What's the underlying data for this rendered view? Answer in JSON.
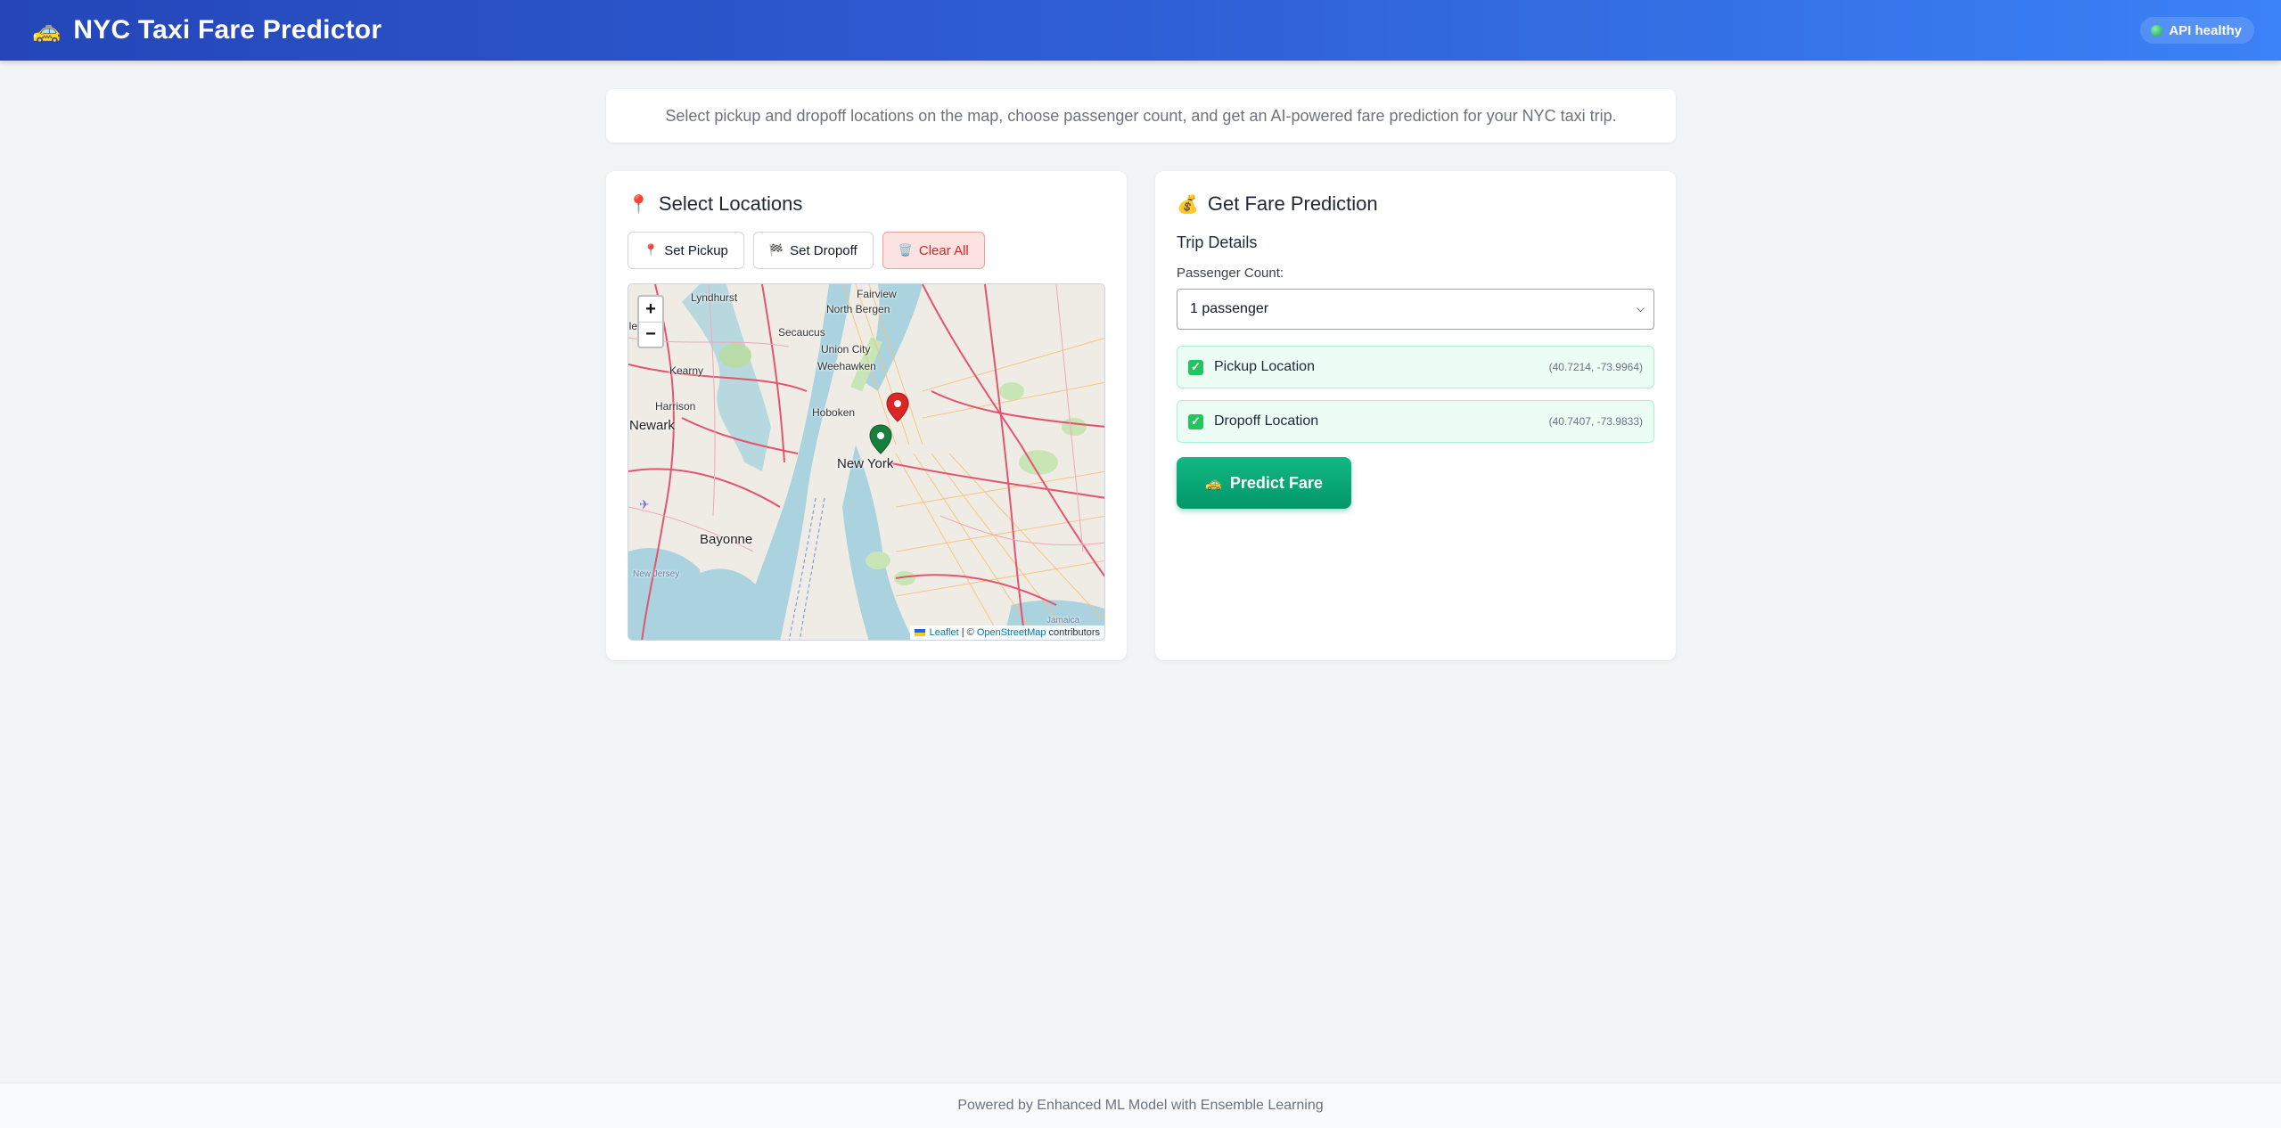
{
  "header": {
    "icon": "taxi-icon",
    "title": "NYC Taxi Fare Predictor",
    "api_status": "API healthy",
    "api_status_color": "#22c55e"
  },
  "intro": {
    "text": "Select pickup and dropoff locations on the map, choose passenger count, and get an AI-powered fare prediction for your NYC taxi trip."
  },
  "locations_card": {
    "icon": "pin-icon",
    "title": "Select Locations",
    "buttons": {
      "set_pickup": "Set Pickup",
      "set_dropoff": "Set Dropoff",
      "clear_all": "Clear All"
    },
    "map": {
      "zoom_in": "+",
      "zoom_out": "−",
      "labels": {
        "lyndhurst": "Lyndhurst",
        "fairview": "Fairview",
        "north_bergen": "North Bergen",
        "belleville": "lleville",
        "secaucus": "Secaucus",
        "union_city": "Union City",
        "kearny": "Kearny",
        "weehawken": "Weehawken",
        "harrison": "Harrison",
        "hoboken": "Hoboken",
        "newark": "Newark",
        "new_york": "New York",
        "bayonne": "Bayonne",
        "new_jersey": "New Jersey",
        "jamaica": "Jamaica"
      },
      "attribution": {
        "leaflet": "Leaflet",
        "separator": " | © ",
        "osm": "OpenStreetMap",
        "suffix": " contributors"
      }
    }
  },
  "prediction_card": {
    "icon": "money-bag-icon",
    "title": "Get Fare Prediction",
    "subtitle": "Trip Details",
    "passenger_label": "Passenger Count:",
    "passenger_value": "1 passenger",
    "pickup": {
      "label": "Pickup Location",
      "coords": "(40.7214, -73.9964)"
    },
    "dropoff": {
      "label": "Dropoff Location",
      "coords": "(40.7407, -73.9833)"
    },
    "predict_button": "Predict Fare"
  },
  "footer": {
    "text": "Powered by Enhanced ML Model with Ensemble Learning"
  },
  "colors": {
    "header_start": "#2446b8",
    "header_end": "#3b82f6",
    "accent_green": "#10b981",
    "clear_red": "#dc2626",
    "pickup_marker": "#15803d",
    "dropoff_marker": "#dc2626"
  }
}
